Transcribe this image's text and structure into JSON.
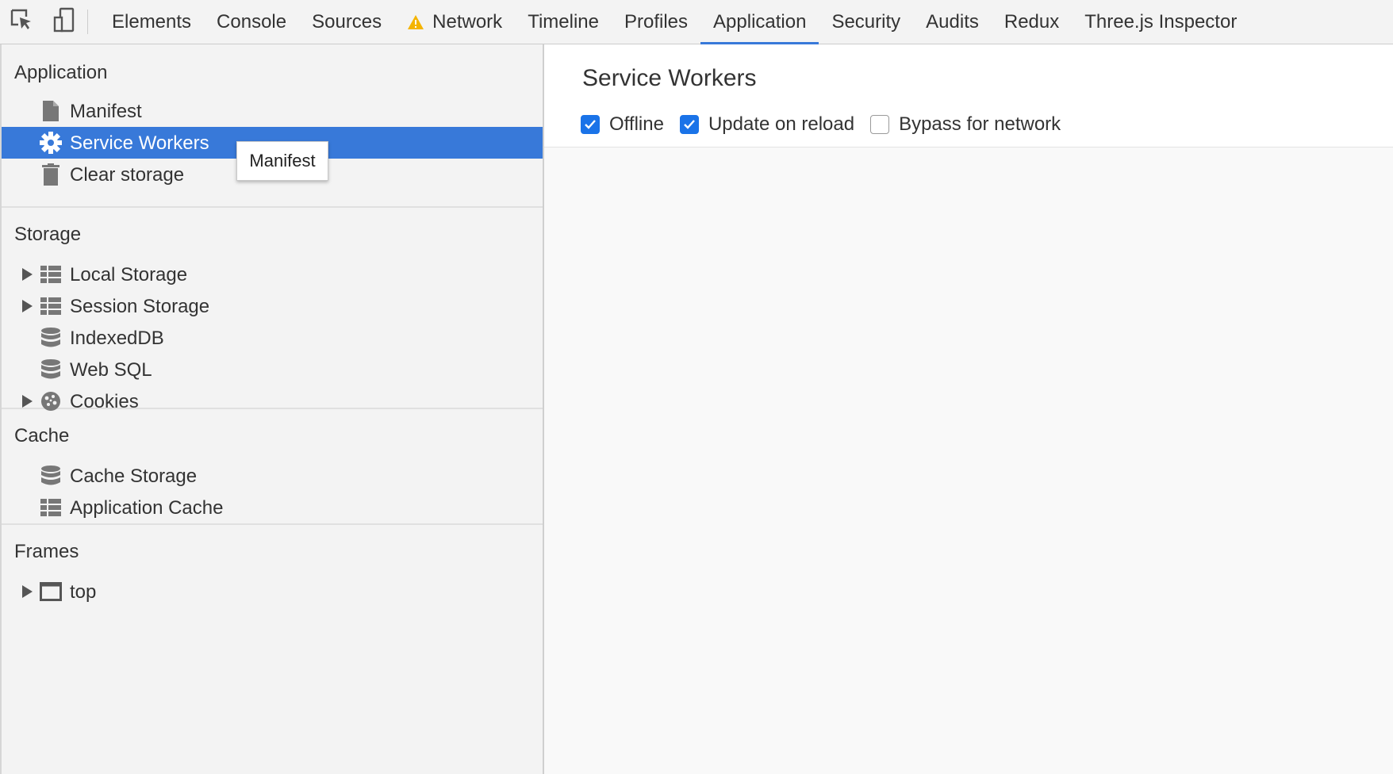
{
  "toolbar": {
    "tabs": [
      {
        "label": "Elements"
      },
      {
        "label": "Console"
      },
      {
        "label": "Sources"
      },
      {
        "label": "Network",
        "warning": true
      },
      {
        "label": "Timeline"
      },
      {
        "label": "Profiles"
      },
      {
        "label": "Application",
        "selected": true
      },
      {
        "label": "Security"
      },
      {
        "label": "Audits"
      },
      {
        "label": "Redux"
      },
      {
        "label": "Three.js Inspector"
      }
    ],
    "icons": [
      "inspect-element-icon",
      "device-mode-icon"
    ],
    "warning_color": "#f4b400",
    "accent": "#3879d9"
  },
  "sidebar": {
    "application": {
      "title": "Application",
      "items": [
        {
          "label": "Manifest",
          "icon": "document-icon"
        },
        {
          "label": "Service Workers",
          "icon": "gear-icon",
          "selected": true
        },
        {
          "label": "Clear storage",
          "icon": "trash-icon"
        }
      ]
    },
    "storage": {
      "title": "Storage",
      "items": [
        {
          "label": "Local Storage",
          "icon": "table-icon",
          "expandable": true
        },
        {
          "label": "Session Storage",
          "icon": "table-icon",
          "expandable": true
        },
        {
          "label": "IndexedDB",
          "icon": "database-icon"
        },
        {
          "label": "Web SQL",
          "icon": "database-icon"
        },
        {
          "label": "Cookies",
          "icon": "cookie-icon",
          "expandable": true
        }
      ]
    },
    "cache": {
      "title": "Cache",
      "items": [
        {
          "label": "Cache Storage",
          "icon": "database-icon"
        },
        {
          "label": "Application Cache",
          "icon": "table-icon"
        }
      ]
    },
    "frames": {
      "title": "Frames",
      "items": [
        {
          "label": "top",
          "icon": "frame-icon",
          "expandable": true
        }
      ]
    }
  },
  "tooltip": {
    "text": "Manifest"
  },
  "main": {
    "title": "Service Workers",
    "options": [
      {
        "label": "Offline",
        "checked": true
      },
      {
        "label": "Update on reload",
        "checked": true
      },
      {
        "label": "Bypass for network",
        "checked": false
      }
    ]
  }
}
